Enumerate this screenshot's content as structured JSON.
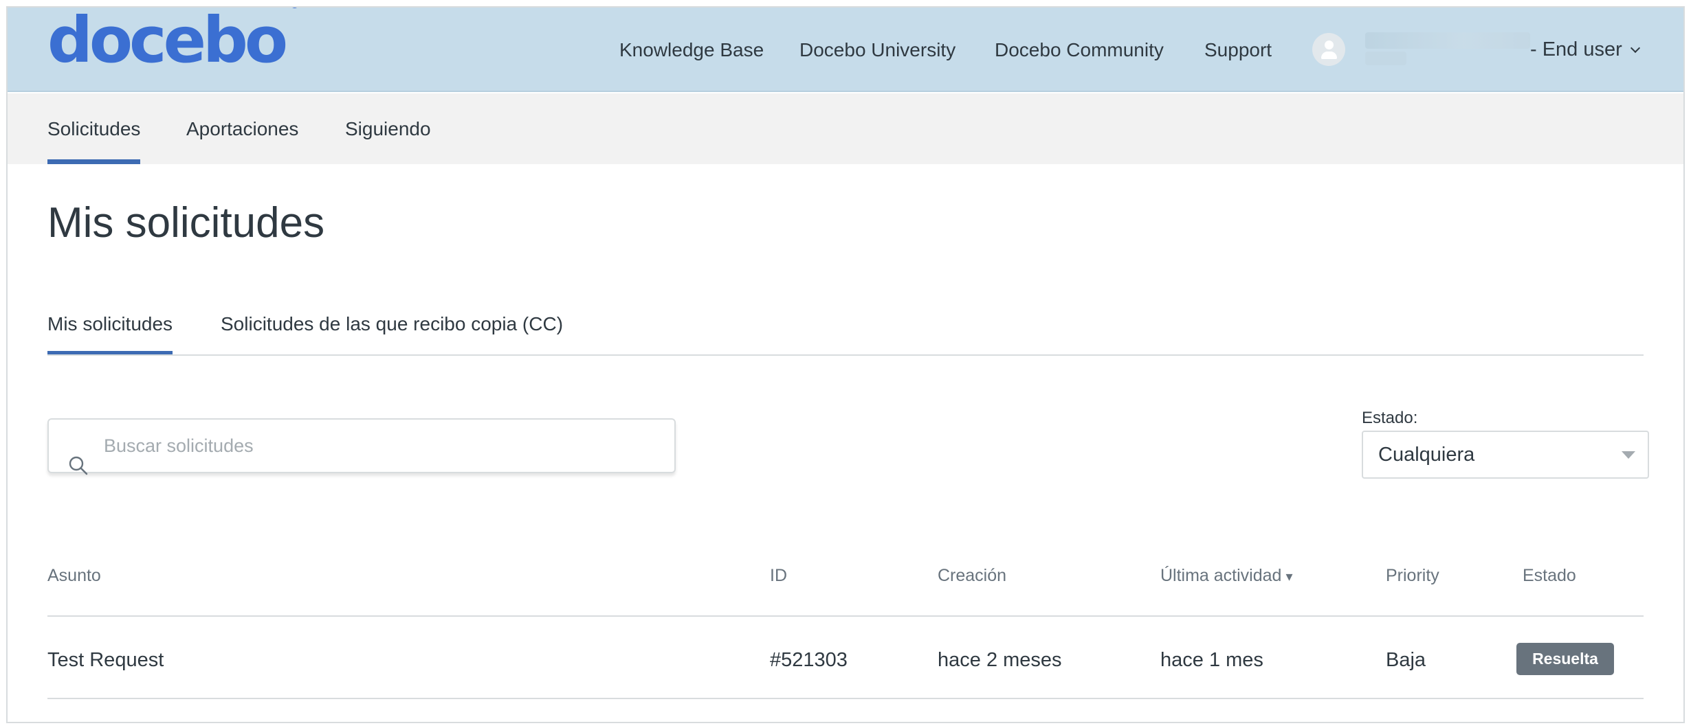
{
  "header": {
    "logo_text": "docebo",
    "logo_mark": "®",
    "nav": [
      {
        "label": "Knowledge Base"
      },
      {
        "label": "Docebo University"
      },
      {
        "label": "Docebo Community"
      },
      {
        "label": "Support"
      }
    ],
    "user": {
      "role": "- End user",
      "avatar_icon": "user-avatar-icon",
      "dropdown_icon": "chevron-down-icon"
    }
  },
  "subnav": {
    "items": [
      {
        "label": "Solicitudes",
        "active": true
      },
      {
        "label": "Aportaciones",
        "active": false
      },
      {
        "label": "Siguiendo",
        "active": false
      }
    ]
  },
  "main": {
    "title": "Mis solicitudes",
    "tabs": [
      {
        "label": "Mis solicitudes",
        "active": true
      },
      {
        "label": "Solicitudes de las que recibo copia (CC)",
        "active": false
      }
    ],
    "search": {
      "placeholder": "Buscar solicitudes",
      "value": "",
      "icon": "search-icon"
    },
    "status_filter": {
      "label": "Estado:",
      "selected": "Cualquiera"
    },
    "table": {
      "columns": {
        "subject": "Asunto",
        "id": "ID",
        "created": "Creación",
        "last_activity": "Última actividad",
        "last_activity_sort": "▾",
        "priority": "Priority",
        "status": "Estado"
      },
      "rows": [
        {
          "subject": "Test Request",
          "id": "#521303",
          "created": "hace 2 meses",
          "last_activity": "hace 1 mes",
          "priority": "Baja",
          "status": "Resuelta"
        }
      ]
    }
  },
  "colors": {
    "header_bg": "#c6dcea",
    "logo": "#3b6fd2",
    "accent": "#3d6bb3",
    "badge_bg": "#68737d"
  }
}
